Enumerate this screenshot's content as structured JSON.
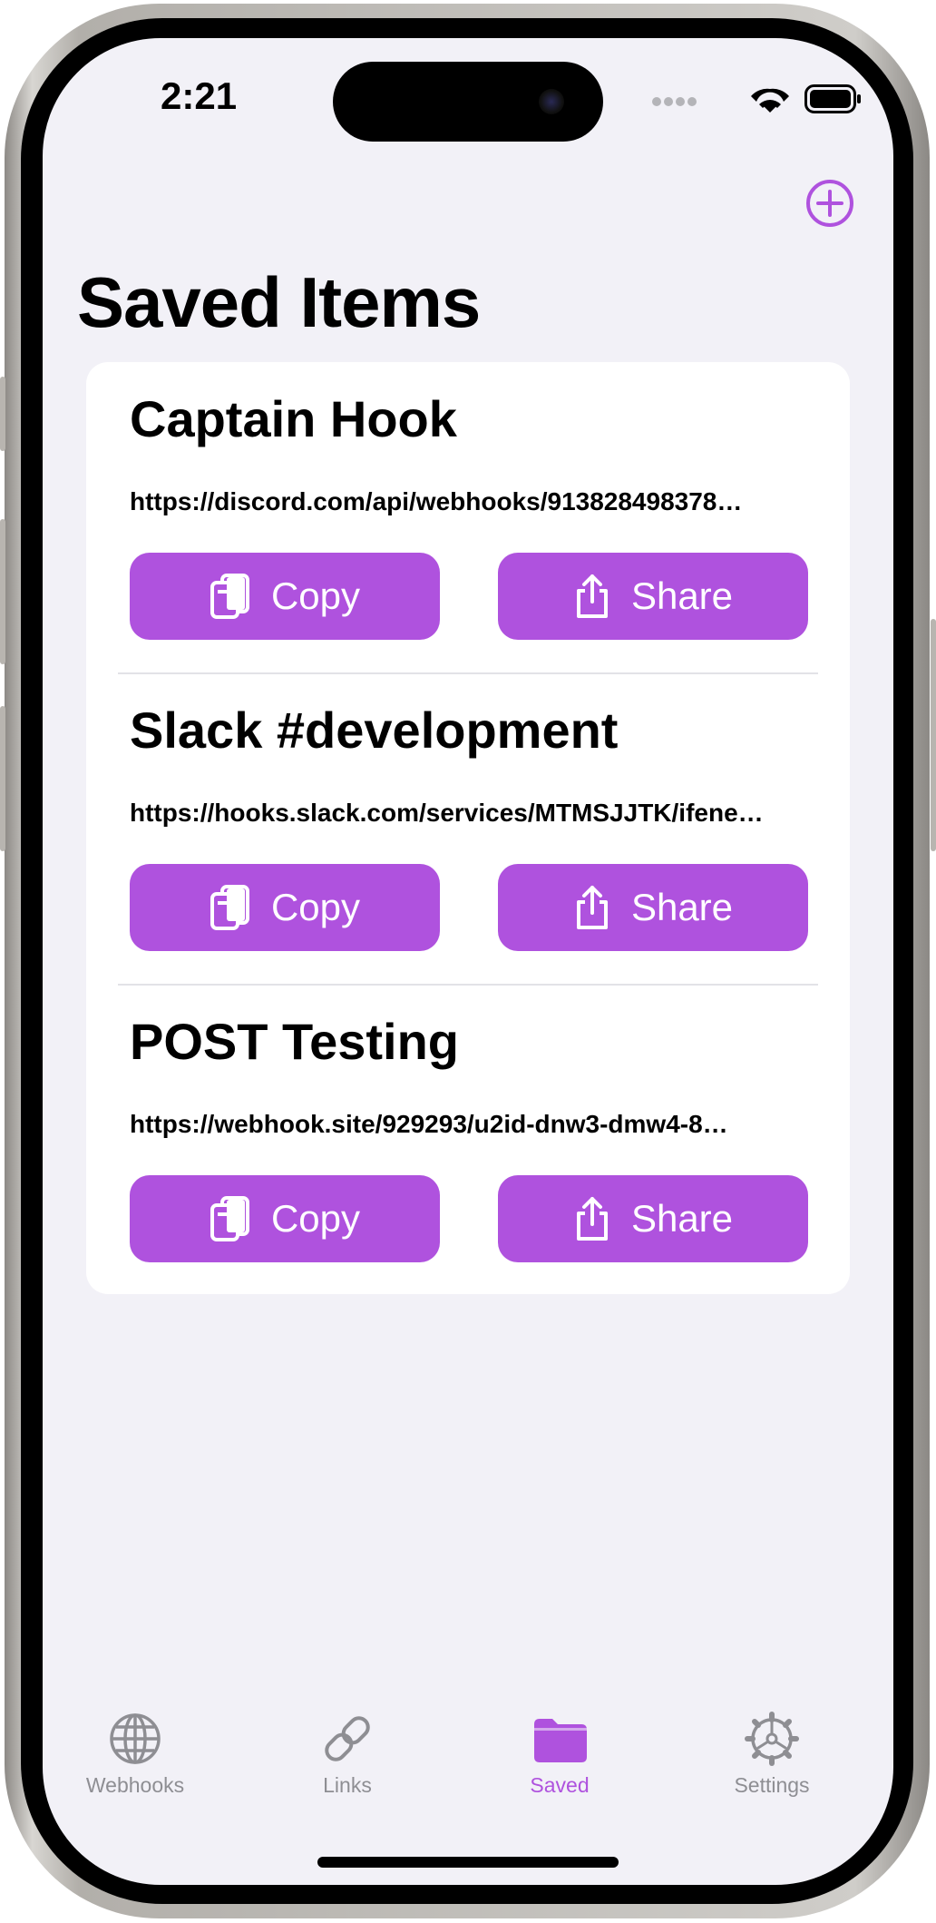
{
  "status_bar": {
    "time": "2:21",
    "icons": [
      "cellular-icon",
      "wifi-icon",
      "battery-icon"
    ]
  },
  "nav": {
    "title": "Saved Items",
    "add_icon": "plus-circle-icon"
  },
  "items": [
    {
      "name": "Captain Hook",
      "url": "https://discord.com/api/webhooks/913828498378…",
      "copy_label": "Copy",
      "share_label": "Share"
    },
    {
      "name": "Slack #development",
      "url": "https://hooks.slack.com/services/MTMSJJTK/ifene…",
      "copy_label": "Copy",
      "share_label": "Share"
    },
    {
      "name": "POST Testing",
      "url": "https://webhook.site/929293/u2id-dnw3-dmw4-8…",
      "copy_label": "Copy",
      "share_label": "Share"
    }
  ],
  "tabs": [
    {
      "label": "Webhooks",
      "icon": "globe-icon",
      "active": false
    },
    {
      "label": "Links",
      "icon": "link-icon",
      "active": false
    },
    {
      "label": "Saved",
      "icon": "folder-icon",
      "active": true
    },
    {
      "label": "Settings",
      "icon": "gear-icon",
      "active": false
    }
  ],
  "colors": {
    "accent": "#af52de",
    "background": "#f2f1f7",
    "card": "#ffffff",
    "tab_inactive": "#8e8e93"
  }
}
